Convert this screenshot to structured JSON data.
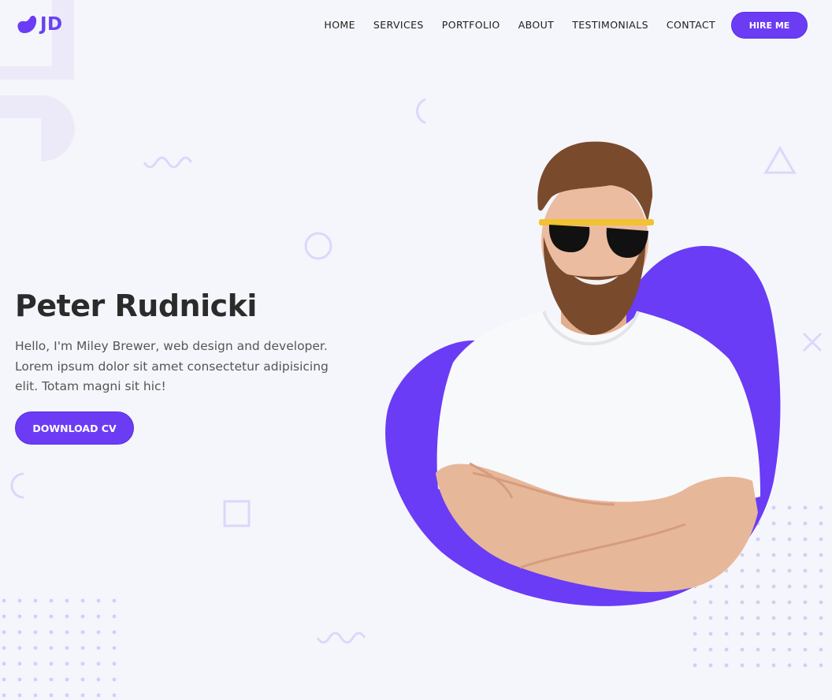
{
  "brand": {
    "logo_text": "JD",
    "accent_color": "#6c3cf5"
  },
  "nav": {
    "items": [
      {
        "label": "HOME"
      },
      {
        "label": "SERVICES"
      },
      {
        "label": "PORTFOLIO"
      },
      {
        "label": "ABOUT"
      },
      {
        "label": "TESTIMONIALS"
      },
      {
        "label": "CONTACT"
      }
    ],
    "cta_label": "HIRE ME"
  },
  "hero": {
    "title": "Peter Rudnicki",
    "description": "Hello, I'm Miley Brewer, web design and developer. Lorem ipsum dolor sit amet consectetur adipisicing elit. Totam magni sit hic!",
    "cta_label": "DOWNLOAD CV",
    "image_subject": "man-in-sunglasses-arms-crossed-portrait"
  },
  "decorations": {
    "icons": [
      "blob-logo-icon",
      "circle-outline-icon",
      "square-outline-icon",
      "triangle-outline-icon",
      "cross-icon",
      "wave-icon",
      "half-circle-icon",
      "dot-grid"
    ]
  }
}
